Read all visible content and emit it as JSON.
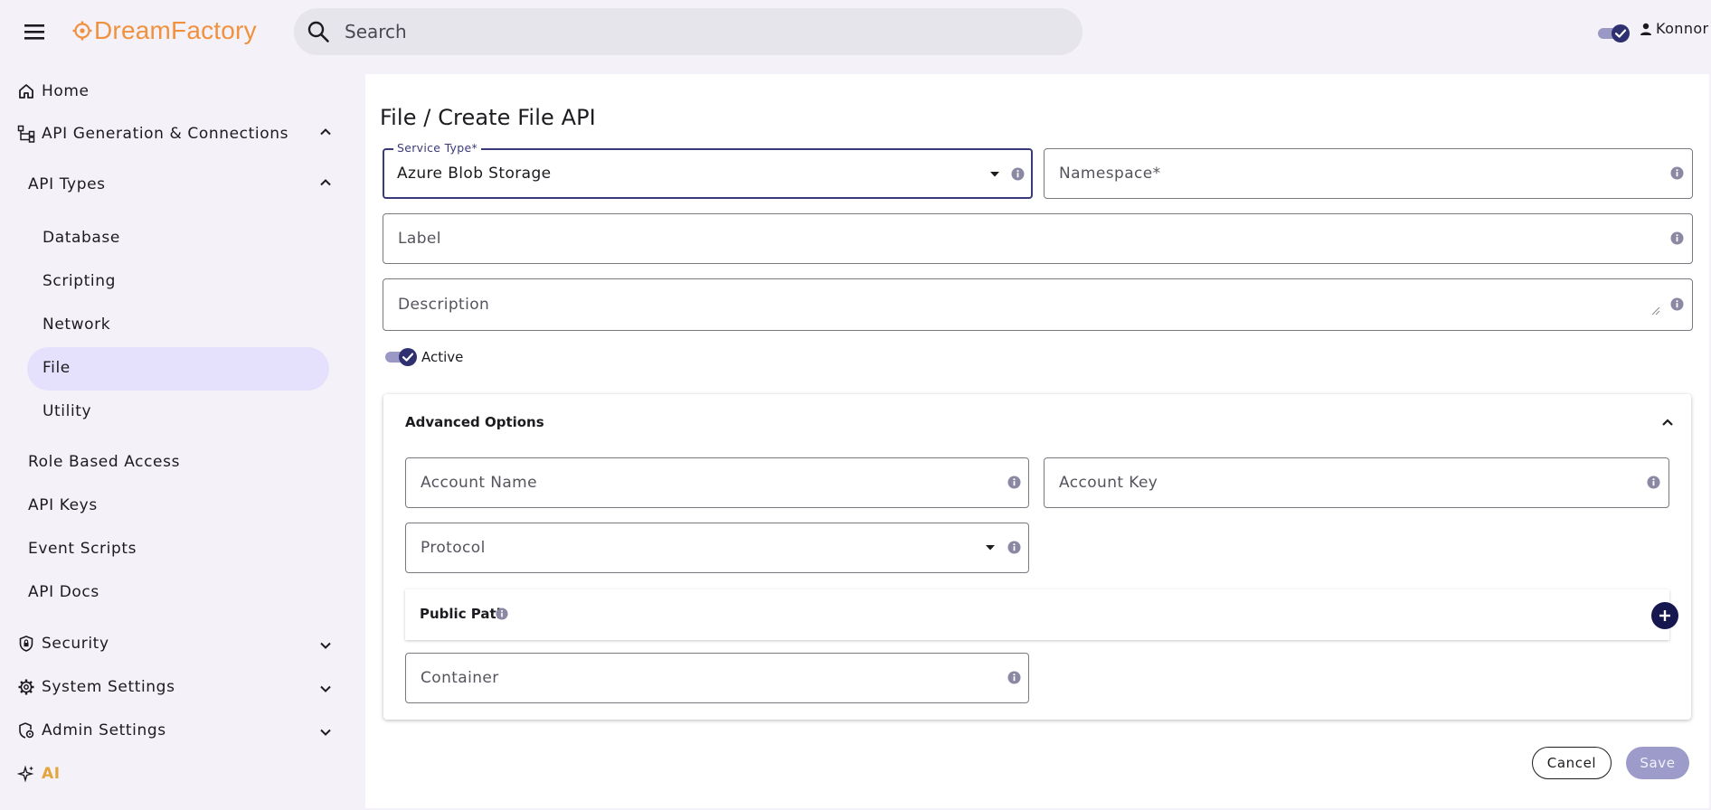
{
  "header": {
    "logo_text": "DreamFactory",
    "search_placeholder": "Search",
    "user_name": "Konnor",
    "theme_toggle_on": true
  },
  "sidebar": {
    "items": [
      {
        "label": "Home",
        "icon": "home-icon"
      },
      {
        "label": "API Generation & Connections",
        "icon": "hierarchy-icon",
        "expanded": true
      },
      {
        "label": "API Types",
        "expanded": true
      },
      {
        "label": "Database"
      },
      {
        "label": "Scripting"
      },
      {
        "label": "Network"
      },
      {
        "label": "File",
        "active": true
      },
      {
        "label": "Utility"
      },
      {
        "label": "Role Based Access"
      },
      {
        "label": "API Keys"
      },
      {
        "label": "Event Scripts"
      },
      {
        "label": "API Docs"
      },
      {
        "label": "Security",
        "icon": "shield-icon",
        "expanded": false
      },
      {
        "label": "System Settings",
        "icon": "gear-icon",
        "expanded": false
      },
      {
        "label": "Admin Settings",
        "icon": "admin-shield-icon",
        "expanded": false
      },
      {
        "label": "AI",
        "icon": "sparkle-icon"
      }
    ]
  },
  "main": {
    "title": "File / Create File API",
    "service_type": {
      "label": "Service Type*",
      "value": "Azure Blob Storage"
    },
    "namespace": {
      "placeholder": "Namespace*"
    },
    "label": {
      "placeholder": "Label"
    },
    "description": {
      "placeholder": "Description"
    },
    "active": {
      "label": "Active",
      "checked": true
    },
    "advanced": {
      "title": "Advanced Options",
      "expanded": true,
      "account_name": {
        "placeholder": "Account Name"
      },
      "account_key": {
        "placeholder": "Account Key"
      },
      "protocol": {
        "placeholder": "Protocol"
      },
      "public_path": {
        "title": "Public Path"
      },
      "container": {
        "placeholder": "Container"
      }
    },
    "buttons": {
      "cancel": "Cancel",
      "save": "Save"
    }
  },
  "colors": {
    "brand_orange": "#f0913f",
    "accent_navy": "#15174e",
    "active_nav_bg": "#e5e0fb",
    "save_disabled": "#9d9bc9"
  }
}
